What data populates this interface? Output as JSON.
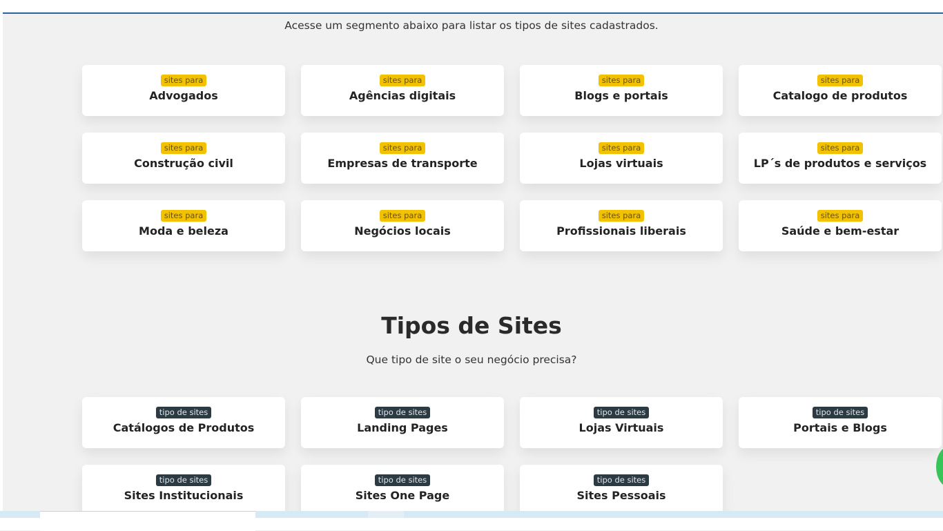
{
  "intro_text": "Acesse um segmento abaixo para listar os tipos de sites cadastrados.",
  "segments": {
    "badge_label": "sites para",
    "items": [
      "Advogados",
      "Agências digitais",
      "Blogs e portais",
      "Catalogo de produtos",
      "Construção civil",
      "Empresas de transporte",
      "Lojas virtuais",
      "LP´s de produtos e serviços",
      "Moda e beleza",
      "Negócios locais",
      "Profissionais liberais",
      "Saúde e bem-estar"
    ]
  },
  "tipos": {
    "title": "Tipos de Sites",
    "subtitle": "Que tipo de site o seu negócio precisa?",
    "badge_label": "tipo de sites",
    "items": [
      "Catálogos de Produtos",
      "Landing Pages",
      "Lojas Virtuais",
      "Portais e Blogs",
      "Sites Institucionais",
      "Sites One Page",
      "Sites Pessoais"
    ]
  },
  "colors": {
    "segment_badge": "#f2c200",
    "tipo_badge": "#2c3a43",
    "header_line": "#2f5fa3",
    "whatsapp_button": "#37c55a"
  },
  "icons": [
    "whatsapp-chat-icon"
  ]
}
